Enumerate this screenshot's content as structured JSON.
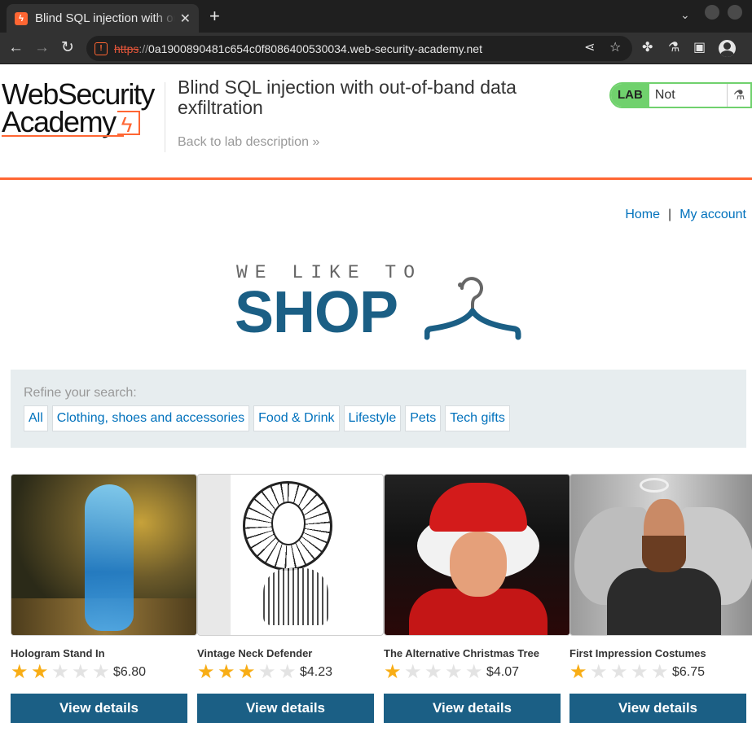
{
  "browser": {
    "tab_title": "Blind SQL injection with out-of-band data exfiltration",
    "tab_close": "✕",
    "new_tab": "+",
    "url_protocol": "https",
    "url_sep": "://",
    "url_host": "0a1900890481c654c0f8086400530034.web-security-academy.net",
    "security_icon": "warning-icon",
    "accent": "#ff6633"
  },
  "academy": {
    "logo_line1": "WebSecurity",
    "logo_line2": "Academy",
    "lab_title": "Blind SQL injection with out-of-band data exfiltration",
    "back_link": "Back to lab description",
    "back_chevron": "»",
    "lab_label": "LAB",
    "lab_status": "Not solved",
    "status_color": "#70d16d"
  },
  "nav": {
    "home": "Home",
    "separator": "|",
    "account": "My account"
  },
  "shop_logo": {
    "tagline": "WE LIKE TO",
    "word": "SHOP"
  },
  "filter": {
    "label": "Refine your search:",
    "categories": [
      "All",
      "Clothing, shoes and accessories",
      "Food & Drink",
      "Lifestyle",
      "Pets",
      "Tech gifts"
    ]
  },
  "products": [
    {
      "name": "Hologram Stand In",
      "rating": 2,
      "price": "$6.80",
      "button": "View details"
    },
    {
      "name": "Vintage Neck Defender",
      "rating": 3,
      "price": "$4.23",
      "button": "View details"
    },
    {
      "name": "The Alternative Christmas Tree",
      "rating": 1,
      "price": "$4.07",
      "button": "View details"
    },
    {
      "name": "First Impression Costumes",
      "rating": 1,
      "price": "$6.75",
      "button": "View details"
    }
  ],
  "colors": {
    "link": "#0071bc",
    "button": "#1b5f85",
    "star_on": "#f8ad15",
    "star_off": "#e3e3e3"
  }
}
